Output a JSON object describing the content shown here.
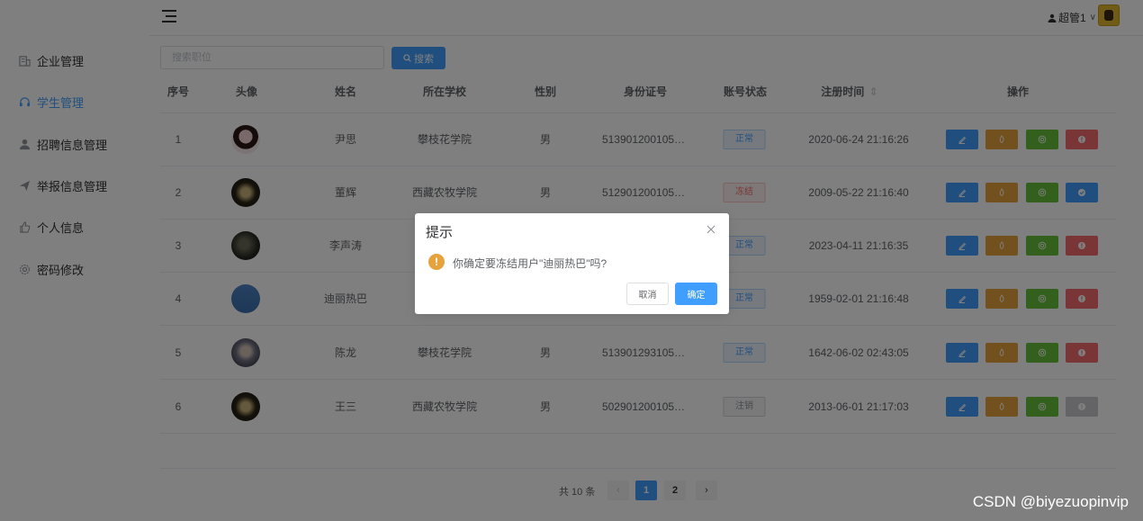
{
  "sidebar": {
    "items": [
      {
        "label": "企业管理",
        "icon": "building-icon",
        "active": false
      },
      {
        "label": "学生管理",
        "icon": "headset-icon",
        "active": true
      },
      {
        "label": "招聘信息管理",
        "icon": "user-icon",
        "active": false
      },
      {
        "label": "举报信息管理",
        "icon": "send-icon",
        "active": false
      },
      {
        "label": "个人信息",
        "icon": "thumb-icon",
        "active": false
      },
      {
        "label": "密码修改",
        "icon": "gear-icon",
        "active": false
      }
    ]
  },
  "header": {
    "username": "超管1",
    "caret": "∨"
  },
  "search": {
    "placeholder": "搜索职位",
    "button_label": "搜索"
  },
  "table": {
    "columns": [
      "序号",
      "头像",
      "姓名",
      "所在学校",
      "性别",
      "身份证号",
      "账号状态",
      "注册时间",
      "操作"
    ],
    "sort_icon": "⇕",
    "rows": [
      {
        "index": "1",
        "name": "尹思",
        "school": "攀枝花学院",
        "gender": "男",
        "id_number": "513901200105…",
        "status": "正常",
        "status_type": "normal",
        "registered": "2020-06-24 21:16:26",
        "action4": "danger"
      },
      {
        "index": "2",
        "name": "董辉",
        "school": "西藏农牧学院",
        "gender": "男",
        "id_number": "512901200105…",
        "status": "冻结",
        "status_type": "frozen",
        "registered": "2009-05-22 21:16:40",
        "action4": "primary"
      },
      {
        "index": "3",
        "name": "李声涛",
        "school": "",
        "gender": "",
        "id_number": "",
        "status": "正常",
        "status_type": "normal",
        "registered": "2023-04-11 21:16:35",
        "action4": "danger"
      },
      {
        "index": "4",
        "name": "迪丽热巴",
        "school": "",
        "gender": "",
        "id_number": "",
        "status": "正常",
        "status_type": "normal",
        "registered": "1959-02-01 21:16:48",
        "action4": "danger"
      },
      {
        "index": "5",
        "name": "陈龙",
        "school": "攀枝花学院",
        "gender": "男",
        "id_number": "513901293105…",
        "status": "正常",
        "status_type": "normal",
        "registered": "1642-06-02 02:43:05",
        "action4": "danger"
      },
      {
        "index": "6",
        "name": "王三",
        "school": "西藏农牧学院",
        "gender": "男",
        "id_number": "502901200105…",
        "status": "注销",
        "status_type": "cancel",
        "registered": "2013-06-01 21:17:03",
        "action4": "info"
      }
    ]
  },
  "pagination": {
    "total_label": "共 10 条",
    "pages": [
      "1",
      "2"
    ],
    "current": "1",
    "prev": "‹",
    "next": "›"
  },
  "dialog": {
    "title": "提示",
    "message": "你确定要冻结用户\"迪丽热巴\"吗?",
    "icon_glyph": "!",
    "cancel_label": "取消",
    "confirm_label": "确定"
  },
  "watermark": "CSDN @biyezuopinvip",
  "colors": {
    "primary": "#409eff",
    "warning": "#e6a23c",
    "success": "#67c23a",
    "danger": "#f56c6c",
    "info": "#c8c9cc"
  }
}
